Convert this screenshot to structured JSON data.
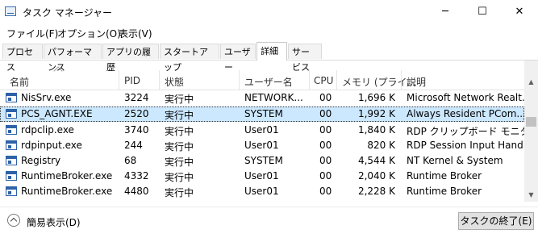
{
  "window": {
    "title": "タスク マネージャー",
    "minimize": "─",
    "maximize": "☐",
    "close": "✕"
  },
  "menu": [
    "ファイル(F)",
    "オプション(O)",
    "表示(V)"
  ],
  "tabs": [
    "プロセス",
    "パフォーマンス",
    "アプリの履歴",
    "スタートアップ",
    "ユーザー",
    "詳細",
    "サービス"
  ],
  "active_tab": "詳細",
  "columns": [
    "名前",
    "PID",
    "状態",
    "ユーザー名",
    "CPU",
    "メモリ (プライ...",
    "説明"
  ],
  "rows": [
    {
      "name": "NisSrv.exe",
      "pid": "3224",
      "status": "実行中",
      "user": "NETWORK...",
      "cpu": "00",
      "mem": "1,696 K",
      "desc": "Microsoft Network Realt..."
    },
    {
      "name": "PCS_AGNT.EXE",
      "pid": "2520",
      "status": "実行中",
      "user": "SYSTEM",
      "cpu": "00",
      "mem": "1,992 K",
      "desc": "Always Resident PCom..."
    },
    {
      "name": "rdpclip.exe",
      "pid": "3740",
      "status": "実行中",
      "user": "User01",
      "cpu": "00",
      "mem": "1,840 K",
      "desc": "RDP クリップボード モニター"
    },
    {
      "name": "rdpinput.exe",
      "pid": "244",
      "status": "実行中",
      "user": "User01",
      "cpu": "00",
      "mem": "820 K",
      "desc": "RDP Session Input Hand..."
    },
    {
      "name": "Registry",
      "pid": "68",
      "status": "実行中",
      "user": "SYSTEM",
      "cpu": "00",
      "mem": "4,544 K",
      "desc": "NT Kernel & System"
    },
    {
      "name": "RuntimeBroker.exe",
      "pid": "4332",
      "status": "実行中",
      "user": "User01",
      "cpu": "00",
      "mem": "2,040 K",
      "desc": "Runtime Broker"
    },
    {
      "name": "RuntimeBroker.exe",
      "pid": "4480",
      "status": "実行中",
      "user": "User01",
      "cpu": "00",
      "mem": "2,228 K",
      "desc": "Runtime Broker"
    }
  ],
  "footer": {
    "fewer_details": "簡易表示(D)",
    "end_task": "タスクの終了(E)"
  },
  "colors": {
    "selected_row": "#cce8ff"
  }
}
